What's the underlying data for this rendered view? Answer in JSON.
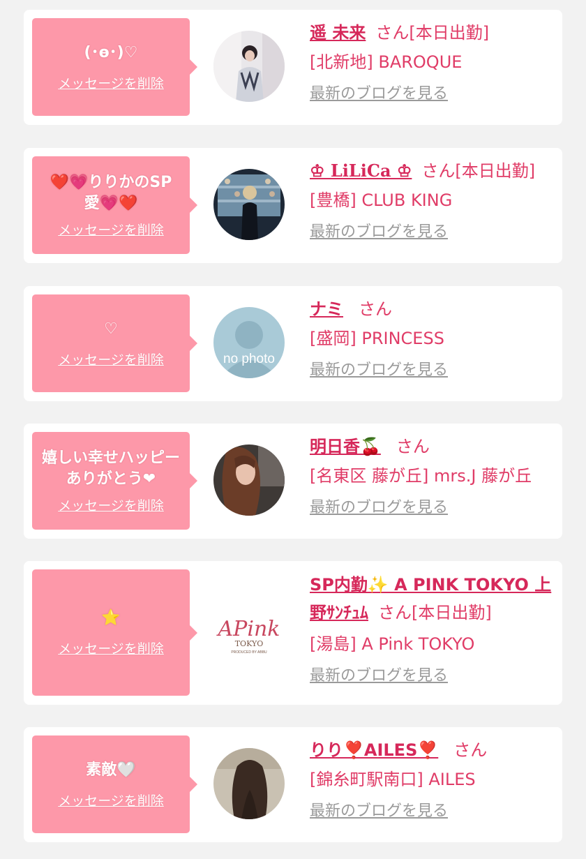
{
  "items": [
    {
      "message": "(･ө･)♡",
      "delete_label": "メッセージを削除",
      "name": "遥 未来",
      "san": "さん",
      "status": "[本日出勤]",
      "shop": "[北新地] BAROQUE",
      "blog_label": "最新のブログを見る",
      "avatar": "photo"
    },
    {
      "message": "❤️💗りりかのSP愛💗❤️",
      "delete_label": "メッセージを削除",
      "name": "♔ LiLiCa ♔",
      "san": "さん",
      "status": "[本日出勤]",
      "shop": "[豊橋] CLUB KING",
      "blog_label": "最新のブログを見る",
      "avatar": "photo"
    },
    {
      "message": "♡",
      "delete_label": "メッセージを削除",
      "name": "ナミ",
      "san": "さん",
      "status": "",
      "shop": "[盛岡] PRINCESS",
      "blog_label": "最新のブログを見る",
      "avatar": "no-photo",
      "avatar_text": "no photo"
    },
    {
      "message": "嬉しい幸せハッピーありがとう❤",
      "delete_label": "メッセージを削除",
      "name": "明日香🍒",
      "san": "さん",
      "status": "",
      "shop": "[名東区 藤が丘] mrs.J 藤が丘",
      "blog_label": "最新のブログを見る",
      "avatar": "photo"
    },
    {
      "message": "⭐",
      "delete_label": "メッセージを削除",
      "name": "SP内勤✨ A PINK TOKYO 上野ｻﾝﾁｭﾑ",
      "san": "さん",
      "status": "[本日出勤]",
      "shop": "[湯島] A Pink TOKYO",
      "blog_label": "最新のブログを見る",
      "avatar": "logo",
      "logo_text": "APink",
      "logo_sub": "TOKYO",
      "logo_small": "PRODUCED BY ABBU"
    },
    {
      "message": "素敵🤍",
      "delete_label": "メッセージを削除",
      "name": "りり❣️AILES❣️",
      "san": "さん",
      "status": "",
      "shop": "[錦糸町駅南口] AILES",
      "blog_label": "最新のブログを見る",
      "avatar": "photo"
    }
  ],
  "colors": {
    "bubble": "#fd98a9",
    "name": "#d6285a",
    "text": "#e03c67",
    "blog": "#9a9a9a",
    "background": "#f2f2f2"
  }
}
